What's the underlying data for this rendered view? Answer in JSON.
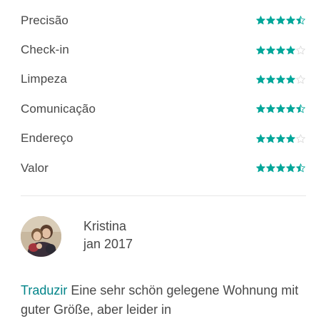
{
  "ratings": {
    "items": [
      {
        "label": "Precisão",
        "stars": 4.5
      },
      {
        "label": "Check-in",
        "stars": 4
      },
      {
        "label": "Limpeza",
        "stars": 4
      },
      {
        "label": "Comunicação",
        "stars": 4.5
      },
      {
        "label": "Endereço",
        "stars": 4
      },
      {
        "label": "Valor",
        "stars": 4.5
      }
    ],
    "max_stars": 5,
    "star_color": "#00a699",
    "empty_star_color": "#d8d8d8"
  },
  "review": {
    "reviewer_name": "Kristina",
    "date": "jan 2017",
    "translate_label": "Traduzir",
    "text": "Eine sehr schön gelegene Wohnung mit guter Größe, aber leider in"
  }
}
